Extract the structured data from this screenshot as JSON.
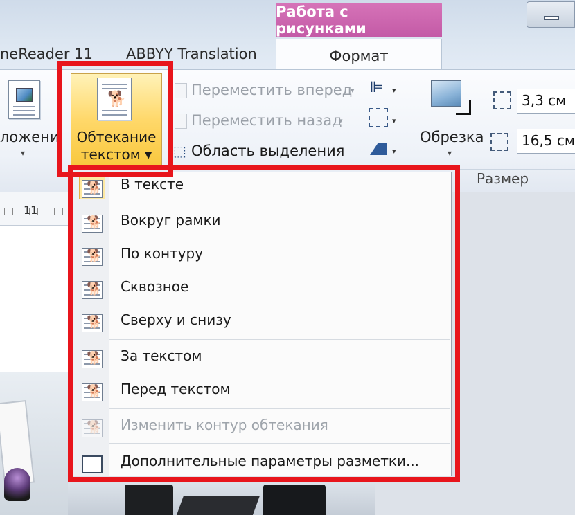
{
  "tabs": {
    "finereader": "neReader 11",
    "abbyy": "ABBYY Translation",
    "context_title": "Работа с рисунками",
    "format": "Формат"
  },
  "ribbon": {
    "position_label": "ложени",
    "wrap_label_line1": "Обтекание",
    "wrap_label_line2": "текстом ▾",
    "bring_forward": "Переместить вперед",
    "send_backward": "Переместить назад",
    "selection_pane": "Область выделения",
    "crop_label": "Обрезка",
    "height_value": "3,3 см",
    "width_value": "16,5 см",
    "size_group_label": "Размер",
    "dropdown_arrow": "▾",
    "small_arrow": "▾"
  },
  "ruler": {
    "number": "11"
  },
  "menu": {
    "items": [
      {
        "label": "В тексте",
        "disabled": false
      },
      {
        "label": "Вокруг рамки",
        "disabled": false
      },
      {
        "label": "По контуру",
        "disabled": false
      },
      {
        "label": "Сквозное",
        "disabled": false
      },
      {
        "label": "Сверху и снизу",
        "disabled": false
      },
      {
        "label": "За текстом",
        "disabled": false
      },
      {
        "label": "Перед текстом",
        "disabled": false
      },
      {
        "label": "Изменить контур обтекания",
        "disabled": true
      },
      {
        "label": "Дополнительные параметры разметки...",
        "disabled": false
      }
    ]
  },
  "icons": {
    "dog": "🐕"
  },
  "colors": {
    "highlight": "#e8151c",
    "context_tab": "#c35aa6",
    "selected_button": "#ffd86a"
  }
}
